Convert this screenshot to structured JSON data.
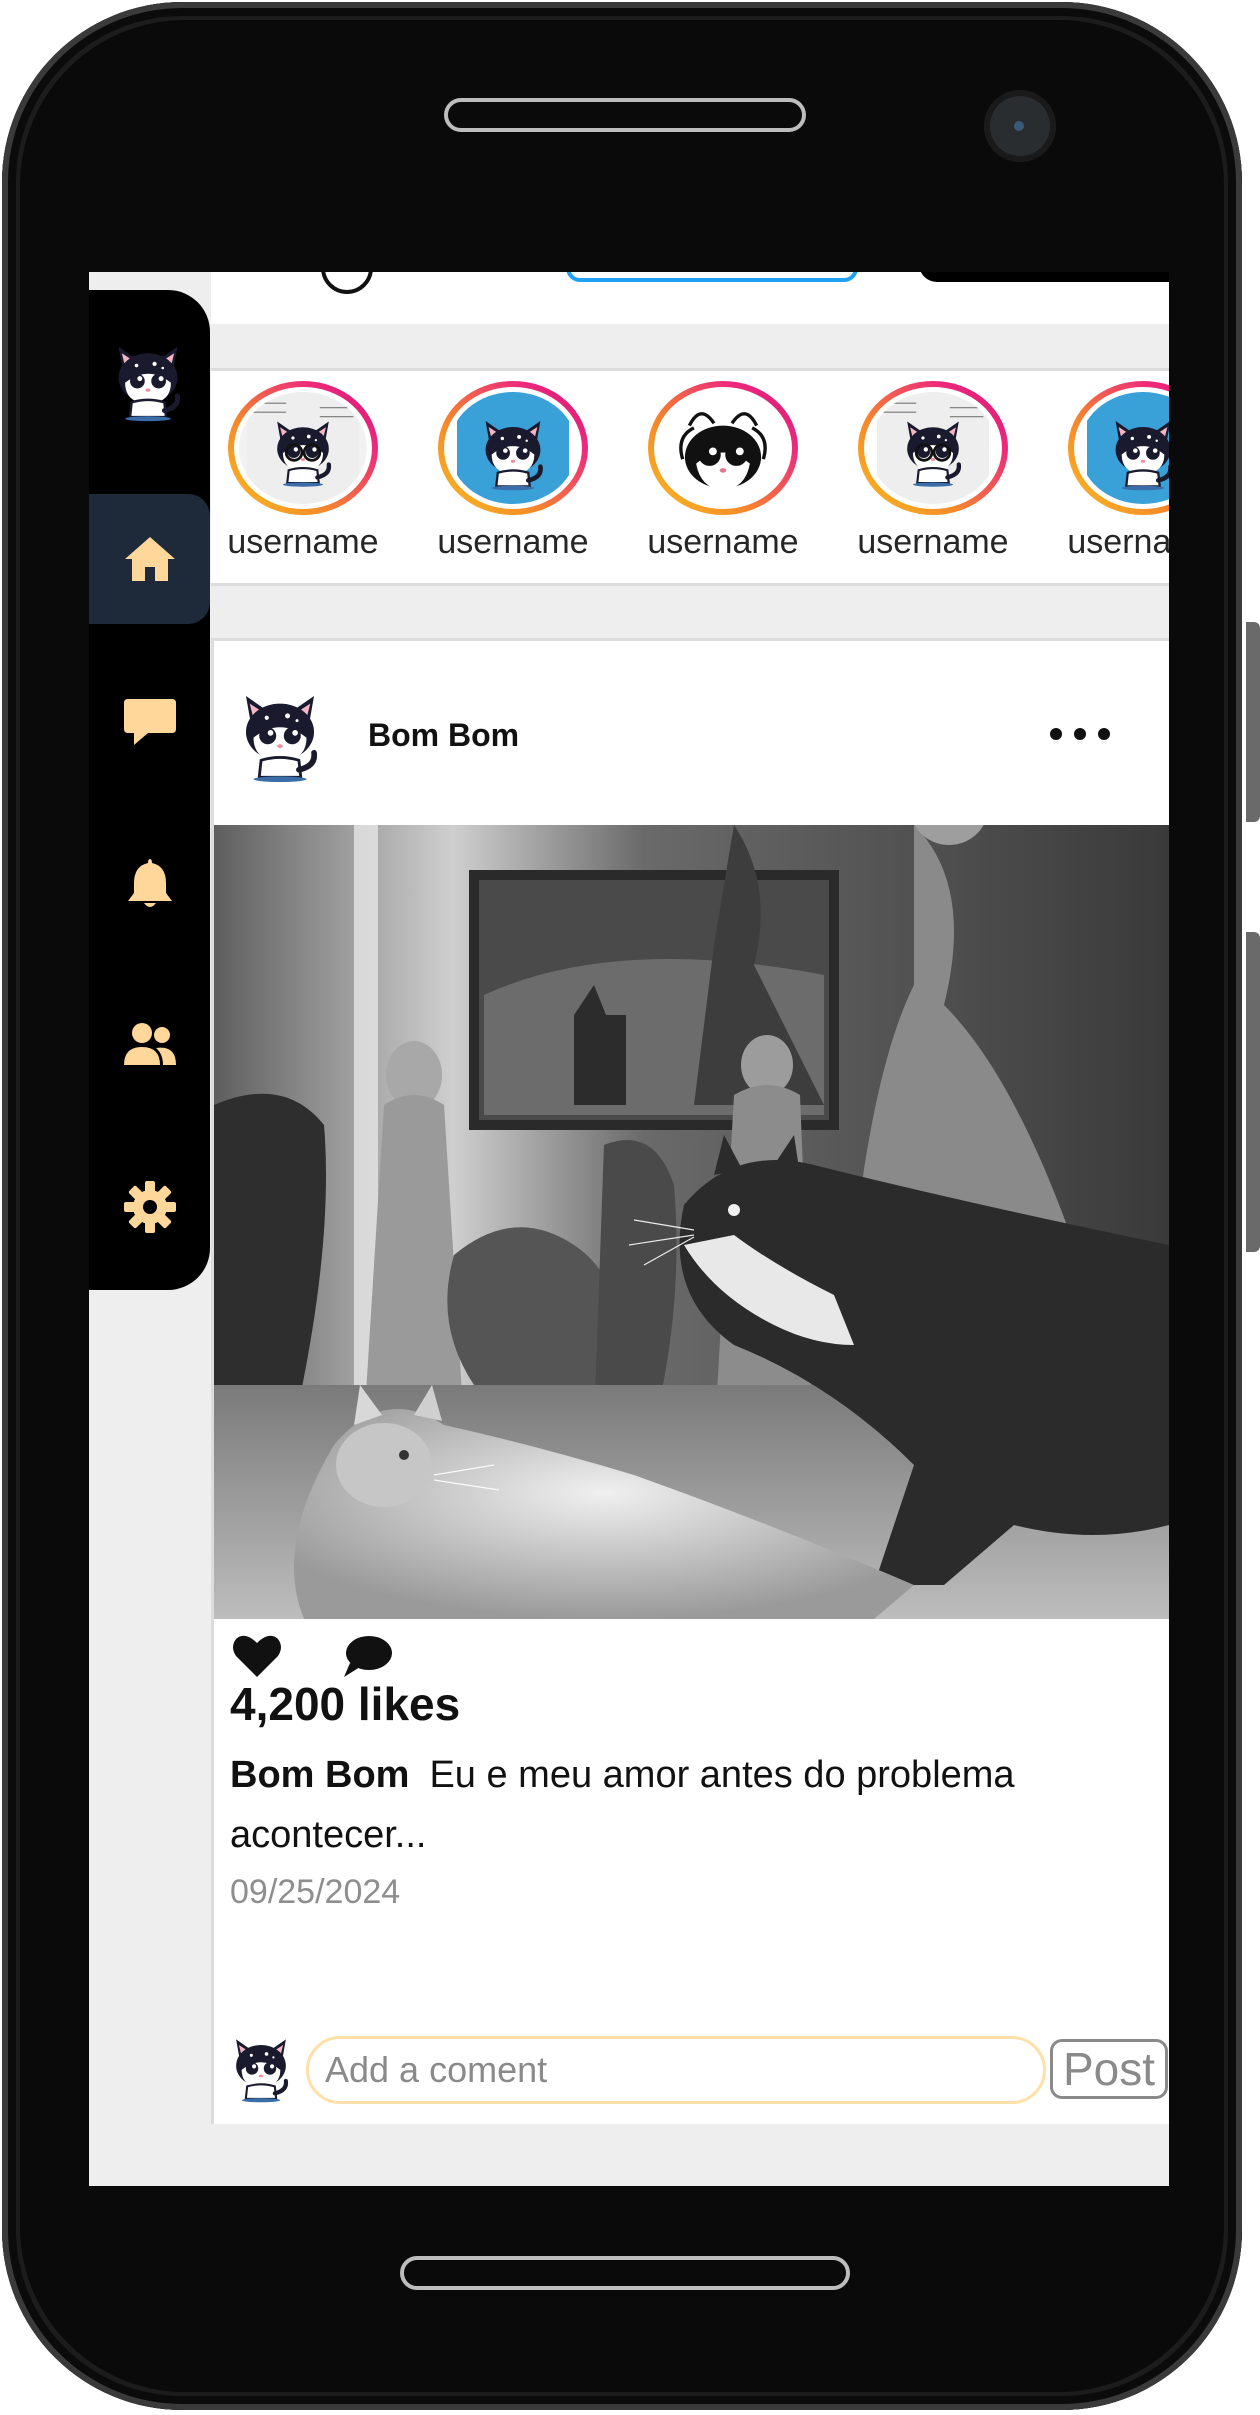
{
  "colors": {
    "accent": "#ffd79a",
    "sidebar_bg": "#000000",
    "sidebar_active": "#1e2a3a",
    "story_ring": [
      "#f9c020",
      "#ee2a7b"
    ],
    "date_text": "#8e8e8e"
  },
  "sidebar": {
    "logo_icon": "cat-logo-icon",
    "items": [
      {
        "name": "home",
        "icon": "home-icon",
        "active": true
      },
      {
        "name": "messages",
        "icon": "chat-bubble-icon",
        "active": false
      },
      {
        "name": "notifications",
        "icon": "bell-icon",
        "active": false
      },
      {
        "name": "friends",
        "icon": "users-icon",
        "active": false
      },
      {
        "name": "settings",
        "icon": "gear-icon",
        "active": false
      }
    ]
  },
  "stories": [
    {
      "username": "username"
    },
    {
      "username": "username"
    },
    {
      "username": "username"
    },
    {
      "username": "username"
    },
    {
      "username": "username"
    }
  ],
  "post": {
    "username": "Bom Bom",
    "likes": "4,200 likes",
    "caption_user": "Bom Bom",
    "caption_text": "Eu e meu amor antes do problema acontecer...",
    "date": "09/25/2024",
    "comment_placeholder": "Add a coment",
    "post_button": "Post"
  }
}
